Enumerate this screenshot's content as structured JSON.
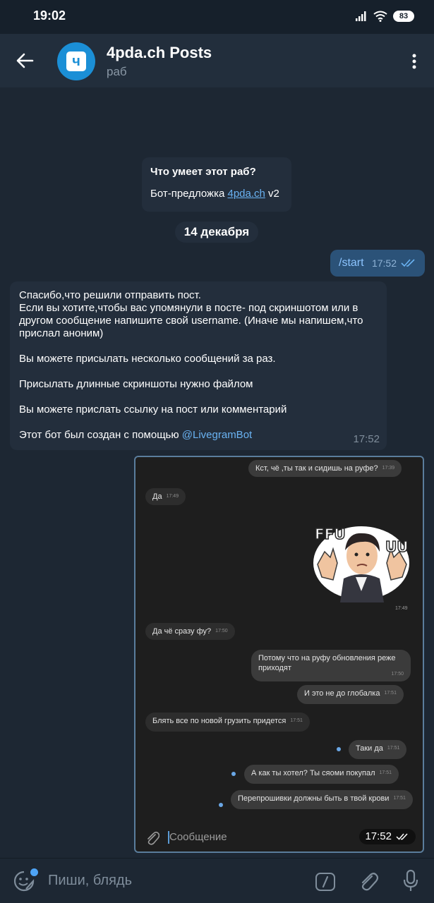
{
  "status_bar": {
    "time": "19:02",
    "battery": "83"
  },
  "header": {
    "title": "4pda.ch Posts",
    "subtitle": "раб",
    "avatar_glyph": "ч"
  },
  "bot_info": {
    "heading": "Что умеет этот раб?",
    "text_prefix": "Бот-предложка ",
    "link": "4pda.ch",
    "text_suffix": " v2"
  },
  "date_separator": "14 декабря",
  "outgoing_message": {
    "text": "/start",
    "time": "17:52"
  },
  "incoming_message": {
    "line1": "Спасибо,что решили отправить пост.",
    "line2": "Если вы хотите,чтобы вас упомянули в посте- под скриншотом или в другом сообщение напишите свой username. (Иначе мы напишем,что прислал аноним)",
    "line3": "Вы можете присылать несколько сообщений за раз.",
    "line4": "Присылать длинные скриншоты нужно файлом",
    "line5": "Вы можете прислать ссылку на пост или комментарий",
    "line6_prefix": "Этот бот был создан с помощью ",
    "line6_link": "@LivegramBot",
    "time": "17:52"
  },
  "screenshot_message": {
    "messages": [
      {
        "text": "Кст, чё ,ты так и сидишь на руфе?",
        "time": "17:39"
      },
      {
        "text": "Да",
        "time": "17:49"
      },
      {
        "sticker_time": "17:49"
      },
      {
        "text": "Да чё сразу фу?",
        "time": "17:50"
      },
      {
        "text": "Потому что на руфу обновления реже приходят",
        "time": "17:50"
      },
      {
        "text": "И это не до глобалка",
        "time": "17:51"
      },
      {
        "text": "Блять все по новой грузить придется",
        "time": "17:51"
      },
      {
        "text": "Таки да",
        "time": "17:51"
      },
      {
        "text": "А как ты хотел? Ты сяоми покупал",
        "time": "17:51"
      },
      {
        "text": "Перепрошивки должны быть в твой крови",
        "time": "17:51"
      }
    ],
    "sticker_text_left": "FFU",
    "sticker_text_right": "UU",
    "input_placeholder": "Сообщение",
    "time": "17:52"
  },
  "composer": {
    "placeholder": "Пиши, блядь"
  },
  "colors": {
    "background": "#1d2733",
    "header": "#222e3c",
    "bubble_in": "#232e3c",
    "bubble_out": "#2b5278",
    "link": "#6ab3f3",
    "accent": "#4ea4f6"
  },
  "icons": [
    "back-arrow-icon",
    "more-vertical-icon",
    "signal-icon",
    "wifi-icon",
    "battery-icon",
    "double-check-icon",
    "paperclip-icon",
    "sticker-emoji-icon",
    "slash-command-icon",
    "microphone-icon"
  ]
}
